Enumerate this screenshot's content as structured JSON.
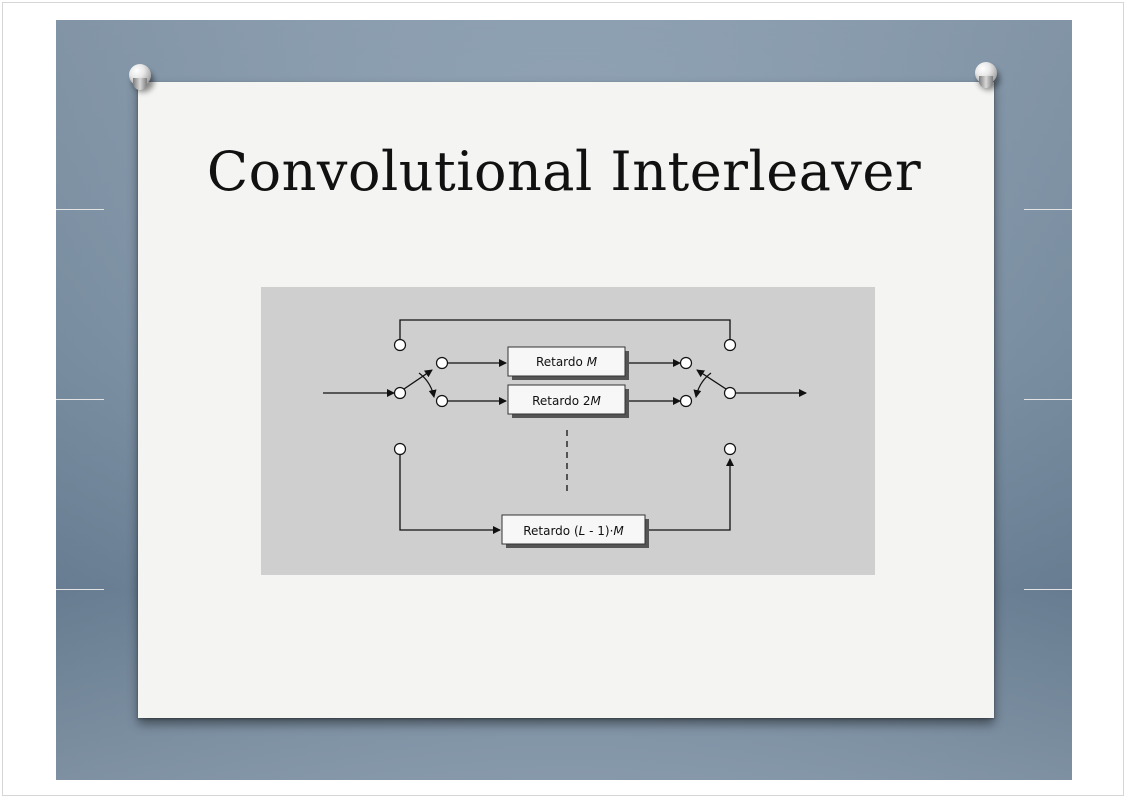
{
  "slide": {
    "title": "Convolutional Interleaver"
  },
  "diagram": {
    "delay_boxes": [
      {
        "prefix": "Retardo ",
        "var": "M",
        "suffix": ""
      },
      {
        "prefix": "Retardo 2",
        "var": "M",
        "suffix": ""
      },
      {
        "prefix": "Retardo (",
        "var": "L",
        "suffix": " - 1)·",
        "var2": "M"
      }
    ]
  }
}
